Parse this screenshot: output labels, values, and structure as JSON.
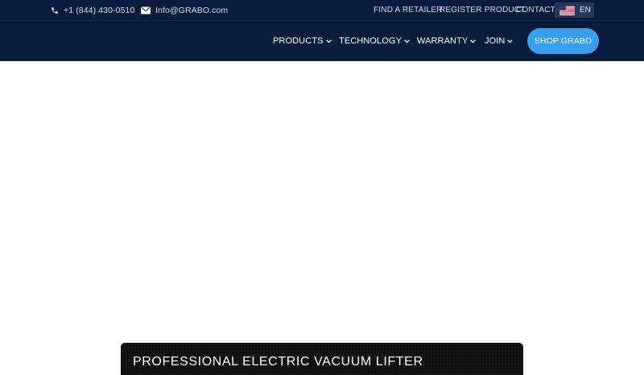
{
  "topbar": {
    "phone": "+1 (844) 430-0510",
    "email": "Info@GRABO.com",
    "links": [
      "FIND A RETAILER",
      "REGISTER PRODUCT",
      "CONTACT"
    ],
    "language": "EN"
  },
  "nav": {
    "items": [
      "PRODUCTS",
      "TECHNOLOGY",
      "WARRANTY",
      "JOIN"
    ],
    "cta": "SHOP GRABO"
  },
  "hero": {
    "headline": "PROFESSIONAL ELECTRIC VACUUM LIFTER"
  },
  "colors": {
    "header_bg": "#0a1c3d",
    "cta_bg": "#3aa0ee",
    "panel_bg": "#101010"
  },
  "icons": [
    "phone-icon",
    "mail-icon",
    "us-flag-icon",
    "chevron-down-icon"
  ]
}
